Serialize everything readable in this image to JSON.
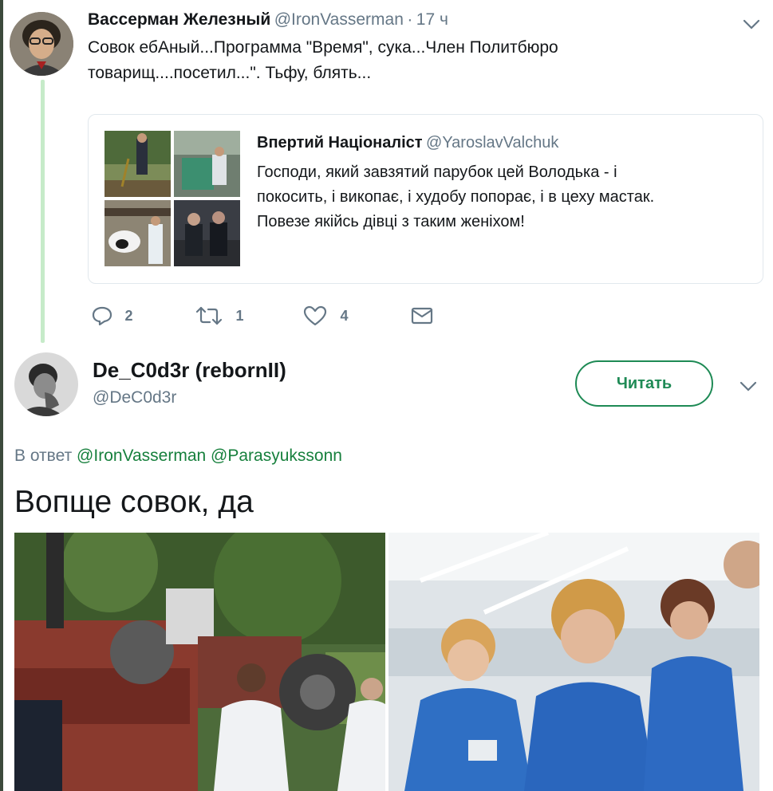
{
  "tweet1": {
    "author_name": "Вассерман Железный",
    "author_handle": "@IronVasserman",
    "separator": "·",
    "time": "17 ч",
    "text_line1": "Совок ебАный...Программа \"Время\", сука...Член Политбюро",
    "text_line2": "товарищ....посетил...\". Тьфу, блять...",
    "quoted": {
      "author_name": "Впертий Націоналіст",
      "author_handle": "@YaroslavValchuk",
      "text_line1": "Господи, який завзятий парубок цей Володька - і",
      "text_line2": "покосить, і викопає, і худобу попорає, і в цеху мастак.",
      "text_line3": "Повезе якійсь дівці з таким женіхом!"
    },
    "actions": {
      "reply_count": "2",
      "retweet_count": "1",
      "like_count": "4"
    }
  },
  "tweet2": {
    "author_name": "De_C0d3r (rebornII)",
    "author_handle": "@DeC0d3r",
    "follow_label": "Читать",
    "reply_prefix": "В ответ",
    "reply_to_1": "@IronVasserman",
    "reply_to_2": "@Parasyukssonn",
    "text": "Вопще совок, да"
  },
  "icons": [
    "chevron-down-icon",
    "reply-icon",
    "retweet-icon",
    "like-icon",
    "message-icon"
  ],
  "colors": {
    "accent": "#1e8a55",
    "thread_line": "#c6ebc9",
    "muted": "#657786"
  }
}
